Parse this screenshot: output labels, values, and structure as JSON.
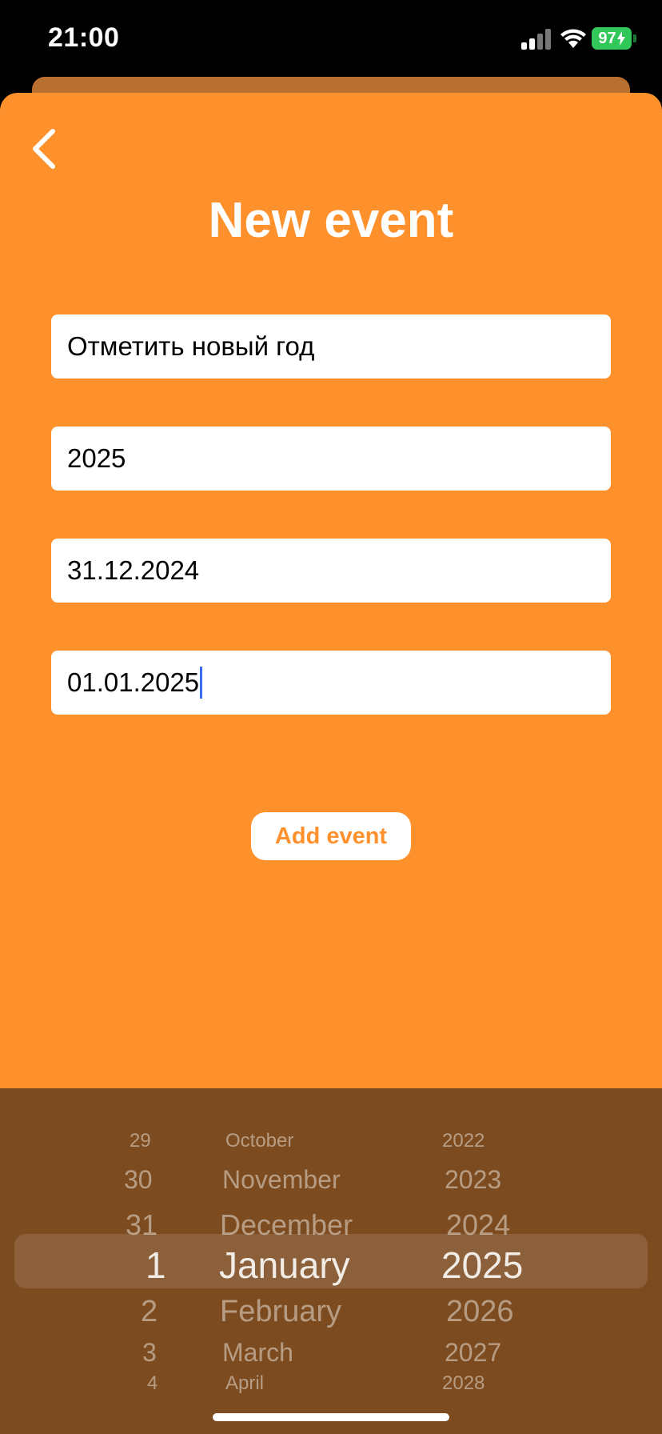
{
  "status_bar": {
    "time": "21:00",
    "battery": "97"
  },
  "header": {
    "title": "New event"
  },
  "form": {
    "fields": [
      {
        "value": "Отметить новый год"
      },
      {
        "value": "2025"
      },
      {
        "value": "31.12.2024"
      },
      {
        "value": "01.01.2025"
      }
    ],
    "add_label": "Add event"
  },
  "picker": {
    "days": [
      "29",
      "30",
      "31",
      "1",
      "2",
      "3",
      "4"
    ],
    "months": [
      "October",
      "November",
      "December",
      "January",
      "February",
      "March",
      "April"
    ],
    "years": [
      "2022",
      "2023",
      "2024",
      "2025",
      "2026",
      "2027",
      "2028"
    ],
    "selected": {
      "day": "1",
      "month": "January",
      "year": "2025"
    }
  },
  "colors": {
    "sheet": "#ff912c",
    "picker_bg": "#7c4b1f",
    "battery": "#32c759",
    "caret": "#3c6cf0"
  }
}
